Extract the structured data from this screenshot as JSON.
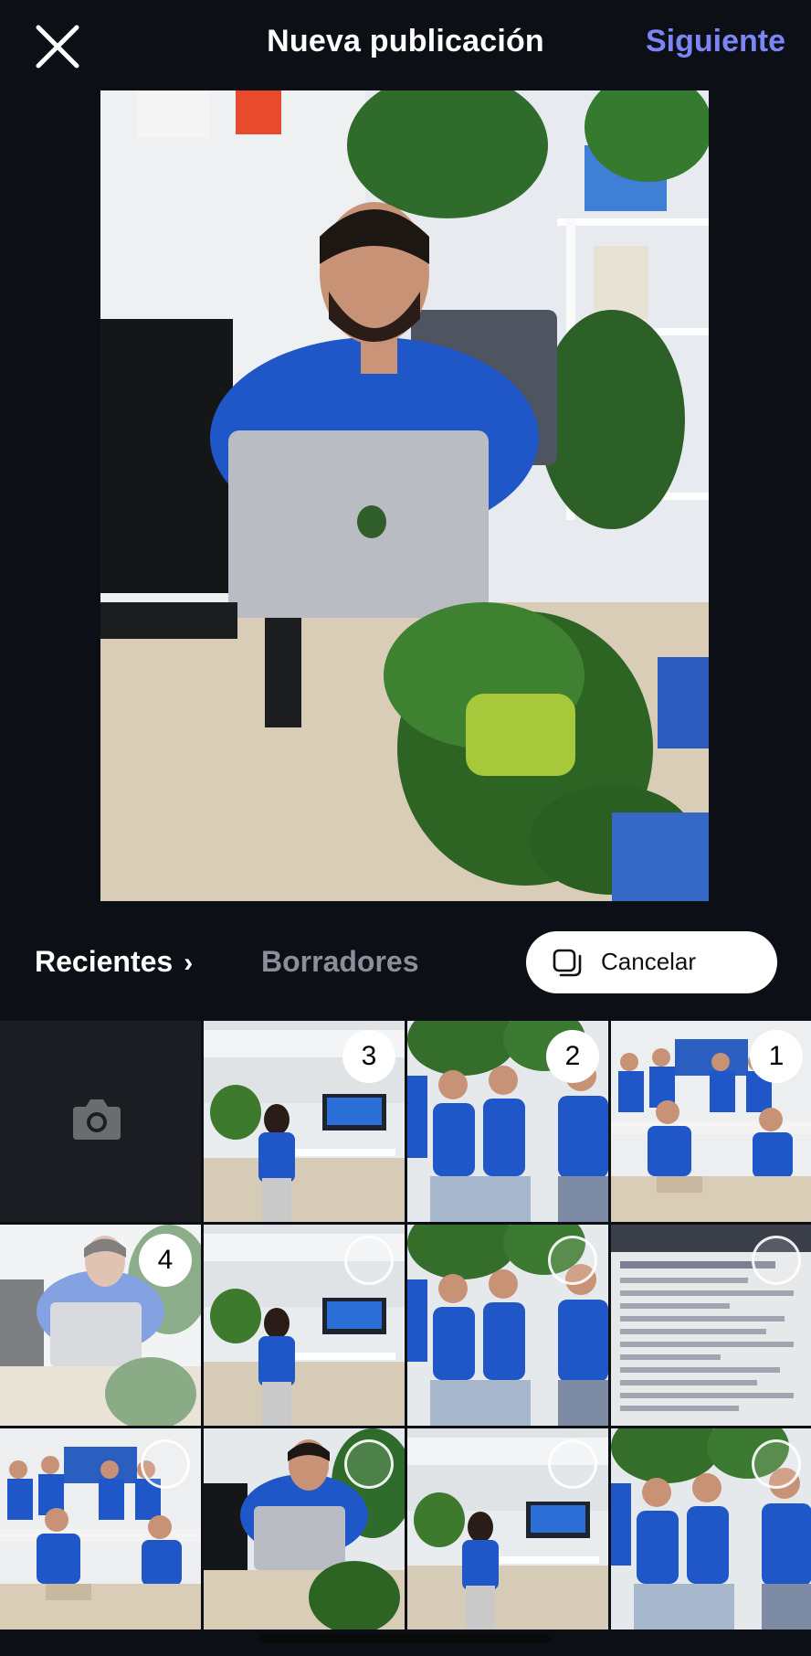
{
  "header": {
    "title": "Nueva publicación",
    "next_label": "Siguiente"
  },
  "tabs": {
    "recent_label": "Recientes",
    "drafts_label": "Borradores",
    "cancel_label": "Cancelar"
  },
  "grid": {
    "camera_icon": "camera-icon",
    "cells": [
      {
        "scene": "office",
        "selected": "3"
      },
      {
        "scene": "group",
        "selected": "2"
      },
      {
        "scene": "team",
        "selected": "1"
      },
      {
        "scene": "man-laptop",
        "selected": "4"
      },
      {
        "scene": "office",
        "selected": ""
      },
      {
        "scene": "group",
        "selected": ""
      },
      {
        "scene": "document",
        "selected": ""
      },
      {
        "scene": "team",
        "selected": ""
      },
      {
        "scene": "man-laptop",
        "selected": ""
      },
      {
        "scene": "office",
        "selected": ""
      },
      {
        "scene": "group",
        "selected": ""
      }
    ]
  },
  "colors": {
    "background": "#0c1016",
    "accent": "#7b85f5",
    "shirt_blue": "#1f57c9"
  }
}
